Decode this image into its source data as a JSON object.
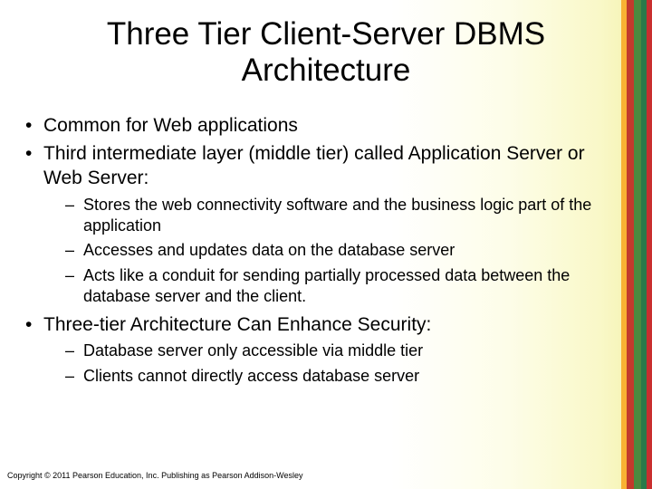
{
  "title": "Three Tier Client-Server DBMS Architecture",
  "bullets": [
    {
      "text": "Common for Web applications"
    },
    {
      "text": "Third intermediate layer (middle tier) called Application Server or Web Server:",
      "sub": [
        "Stores the web connectivity software and the business logic part of the application",
        "Accesses and updates data on the database server",
        "Acts like a conduit for sending partially processed data between the database server and the client."
      ]
    },
    {
      "text": "Three-tier Architecture Can Enhance Security:",
      "sub": [
        "Database server only accessible via middle tier",
        "Clients cannot directly access database server"
      ]
    }
  ],
  "copyright": "Copyright © 2011 Pearson Education, Inc. Publishing as Pearson Addison-Wesley"
}
